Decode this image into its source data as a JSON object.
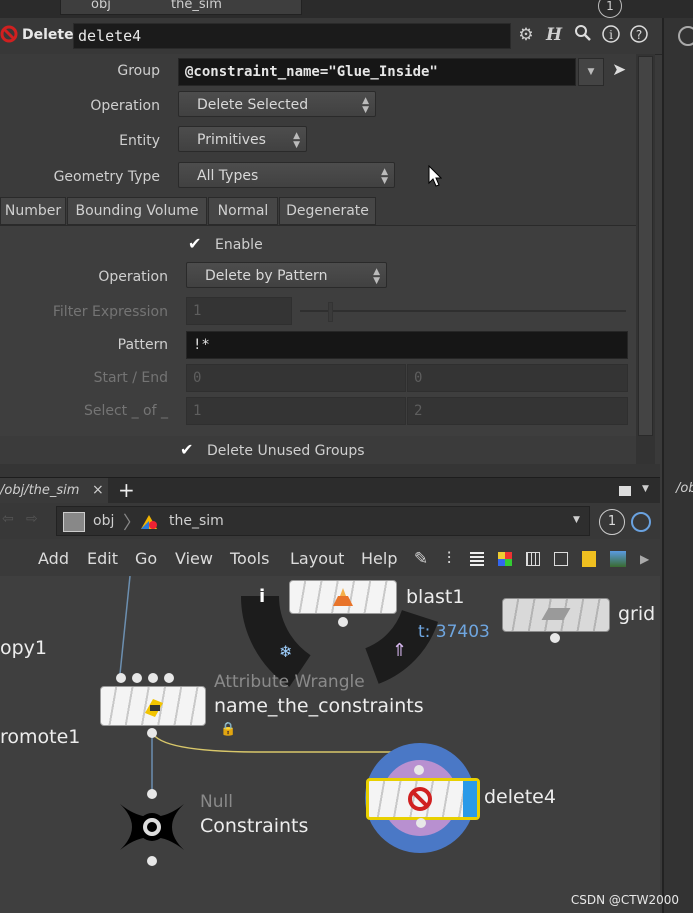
{
  "path_bar_top": {
    "context": "obj",
    "node": "the_sim"
  },
  "header": {
    "node_type": "Delete",
    "node_name": "delete4"
  },
  "params": {
    "group_label": "Group",
    "group_value": "@constraint_name=\"Glue_Inside\"",
    "operation_label": "Operation",
    "operation_value": "Delete Selected",
    "entity_label": "Entity",
    "entity_value": "Primitives",
    "geotype_label": "Geometry Type",
    "geotype_value": "All Types",
    "tabs": [
      "Number",
      "Bounding Volume",
      "Normal",
      "Degenerate"
    ],
    "enable_label": "Enable",
    "operation2_label": "Operation",
    "operation2_value": "Delete by Pattern",
    "filter_label": "Filter Expression",
    "filter_value": "1",
    "pattern_label": "Pattern",
    "pattern_value": "!*",
    "startend_label": "Start / End",
    "start_value": "0",
    "end_value": "0",
    "select_label": "Select _ of _",
    "select_a": "1",
    "select_b": "2",
    "delete_unused_label": "Delete Unused Groups"
  },
  "network": {
    "tab_label": "/obj/the_sim",
    "tab_close": "×",
    "add_tab": "+",
    "path_context": "obj",
    "path_node": "the_sim",
    "right_tab": "/ob",
    "menu": [
      "Add",
      "Edit",
      "Go",
      "View",
      "Tools",
      "Layout",
      "Help"
    ],
    "nodes": {
      "blast": "blast1",
      "blast_info": "t: 37403",
      "grid": "grid",
      "copy": "opy1",
      "promote": "romote1",
      "wrangle_type": "Attribute Wrangle",
      "wrangle_name": "name_the_constraints",
      "null_type": "Null",
      "null_name": "Constraints",
      "delete": "delete4"
    }
  },
  "watermark": "CSDN @CTW2000",
  "badge_number": "1"
}
